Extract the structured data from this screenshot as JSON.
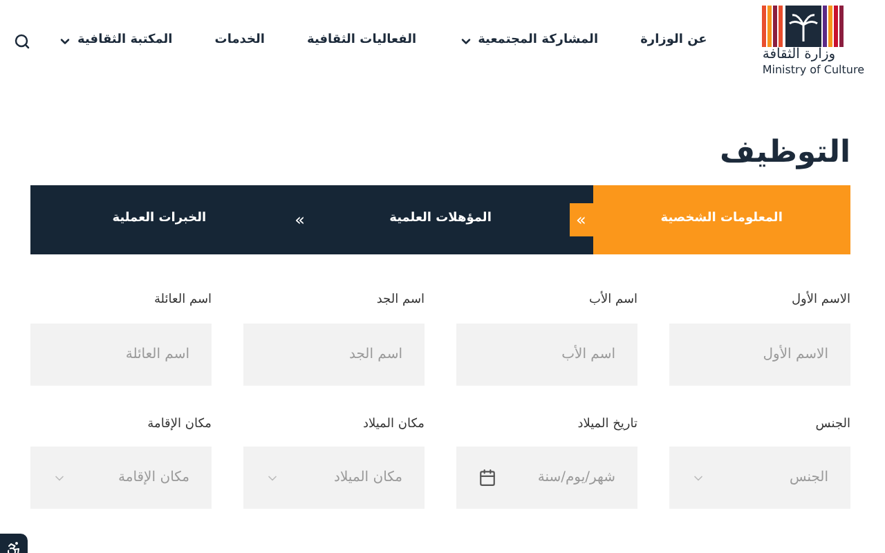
{
  "logo": {
    "arabic": "وزارة الثقافة",
    "english": "Ministry of Culture"
  },
  "nav": [
    {
      "label": "عن الوزارة",
      "dropdown": false
    },
    {
      "label": "المشاركة المجتمعية",
      "dropdown": true
    },
    {
      "label": "الفعاليات الثقافية",
      "dropdown": false
    },
    {
      "label": "الخدمات",
      "dropdown": false
    },
    {
      "label": "المكتبة الثقافية",
      "dropdown": true
    }
  ],
  "page_title": "التوظيف",
  "steps": [
    {
      "label": "المعلومات الشخصية",
      "selected": true,
      "arrow": "»"
    },
    {
      "label": "المؤهلات العلمية",
      "selected": false,
      "arrow": "»"
    },
    {
      "label": "الخبرات العملية",
      "selected": false
    }
  ],
  "fields": [
    {
      "label": "الاسم الأول",
      "placeholder": "الاسم الأول",
      "kind": "text"
    },
    {
      "label": "اسم الأب",
      "placeholder": "اسم الأب",
      "kind": "text"
    },
    {
      "label": "اسم الجد",
      "placeholder": "اسم الجد",
      "kind": "text"
    },
    {
      "label": "اسم العائلة",
      "placeholder": "اسم العائلة",
      "kind": "text"
    },
    {
      "label": "الجنس",
      "placeholder": "الجنس",
      "kind": "select"
    },
    {
      "label": "تاريخ الميلاد",
      "placeholder": "شهر/يوم/سنة",
      "kind": "date"
    },
    {
      "label": "مكان الميلاد",
      "placeholder": "مكان الميلاد",
      "kind": "select"
    },
    {
      "label": "مكان الإقامة",
      "placeholder": "مكان الإقامة",
      "kind": "select"
    }
  ]
}
